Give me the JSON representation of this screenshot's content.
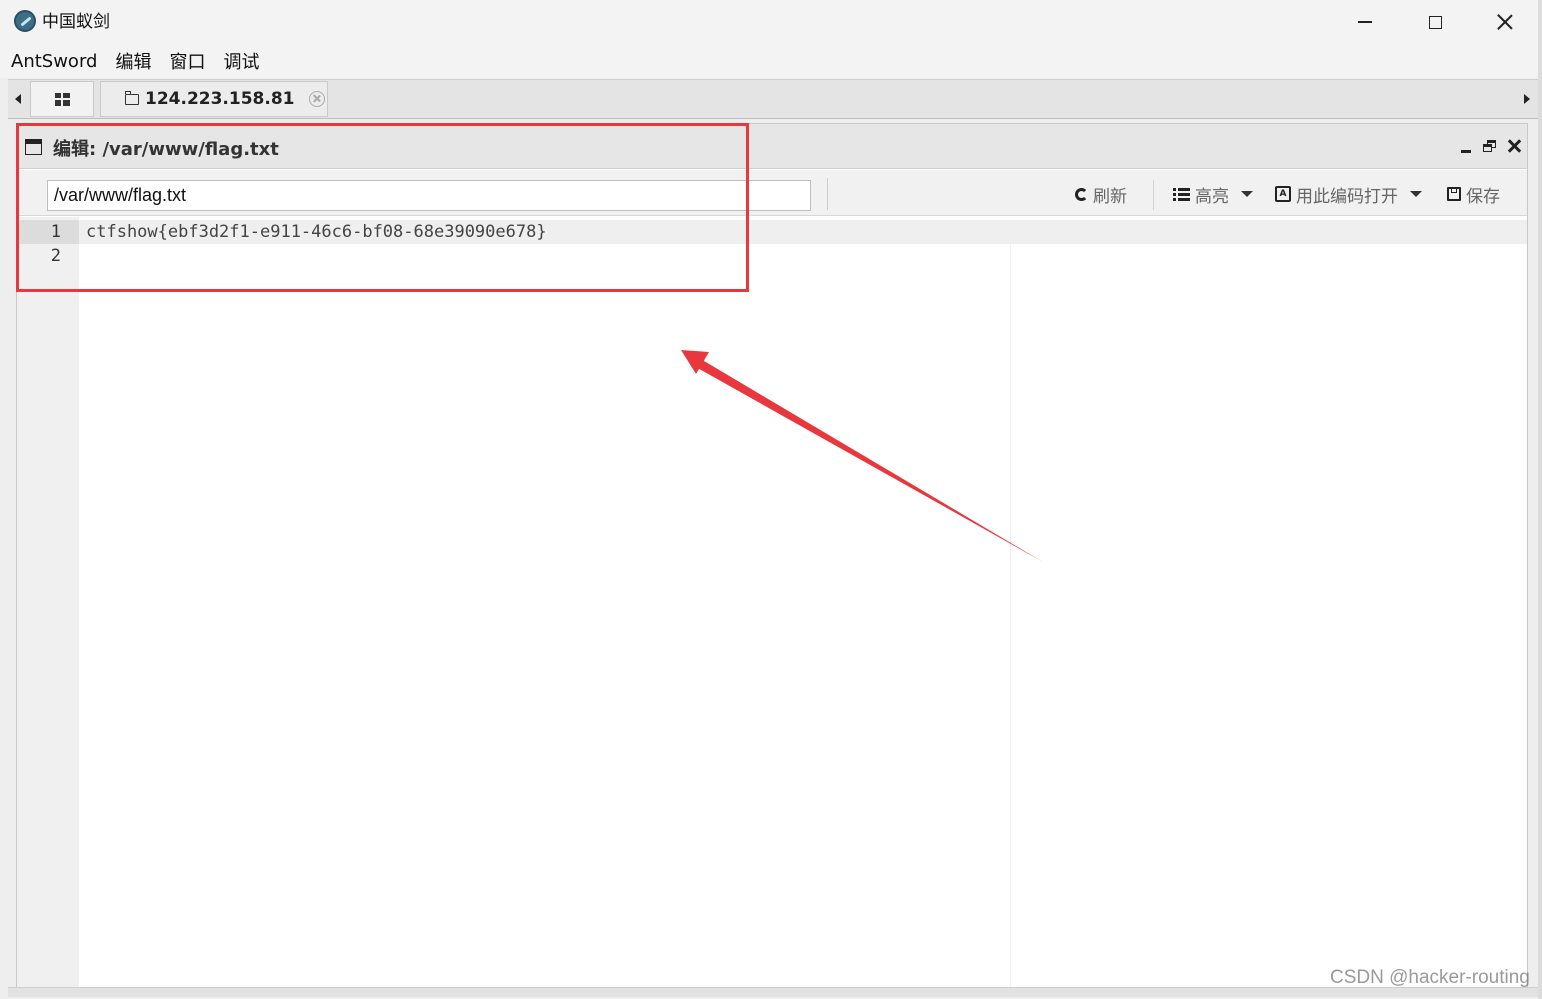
{
  "window": {
    "title": "中国蚁剑",
    "controls": [
      "minimize-icon",
      "maximize-icon",
      "close-icon"
    ]
  },
  "menubar": {
    "items": [
      "AntSword",
      "编辑",
      "窗口",
      "调试"
    ]
  },
  "tabs": {
    "host_label": "124.223.158.81"
  },
  "editor": {
    "title": "编辑: /var/www/flag.txt",
    "path_value": "/var/www/flag.txt",
    "toolbar": {
      "refresh_label": "刷新",
      "highlight_label": "高亮",
      "encoding_label": "用此编码打开",
      "save_label": "保存"
    },
    "line_numbers": [
      "1",
      "2"
    ],
    "lines": [
      "ctfshow{ebf3d2f1-e911-46c6-bf08-68e39090e678}",
      ""
    ]
  },
  "annotation": {
    "color": "#e8383d"
  },
  "watermark": "CSDN @hacker-routing"
}
